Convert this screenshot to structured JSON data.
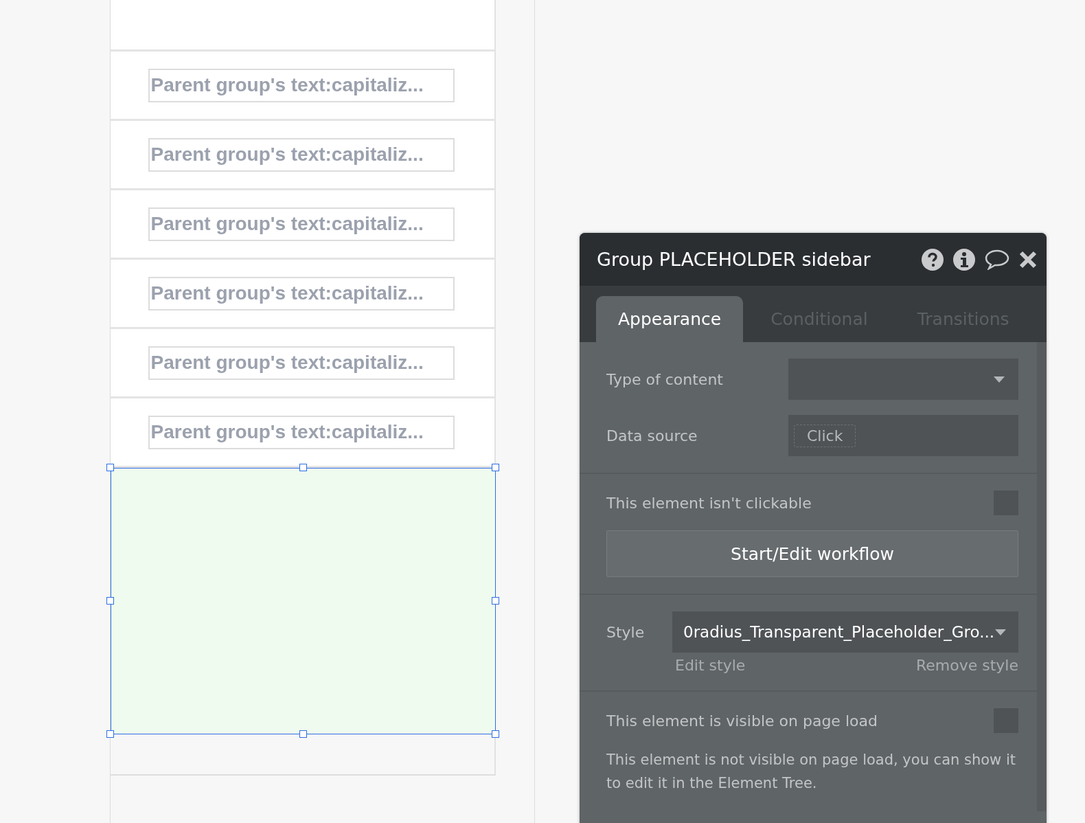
{
  "canvas": {
    "rows": [
      {
        "text": "Parent group's text:capitaliz..."
      },
      {
        "text": "Parent group's text:capitaliz..."
      },
      {
        "text": "Parent group's text:capitaliz..."
      },
      {
        "text": "Parent group's text:capitaliz..."
      },
      {
        "text": "Parent group's text:capitaliz..."
      },
      {
        "text": "Parent group's text:capitaliz..."
      }
    ]
  },
  "panel": {
    "title": "Group PLACEHOLDER sidebar",
    "tabs": [
      {
        "label": "Appearance",
        "selected": true
      },
      {
        "label": "Conditional",
        "selected": false
      },
      {
        "label": "Transitions",
        "selected": false
      }
    ],
    "type_of_content": {
      "label": "Type of content"
    },
    "data_source": {
      "label": "Data source",
      "value": "Click"
    },
    "clickable": {
      "label": "This element isn't clickable",
      "checked": false
    },
    "workflow_button": "Start/Edit workflow",
    "style": {
      "label": "Style",
      "value": "0radius_Transparent_Placeholder_Gro...",
      "edit_link": "Edit style",
      "remove_link": "Remove style"
    },
    "visible": {
      "label": "This element is visible on page load",
      "checked": false
    },
    "note": "This element is not visible on page load, you can show it to edit it in the Element Tree."
  }
}
